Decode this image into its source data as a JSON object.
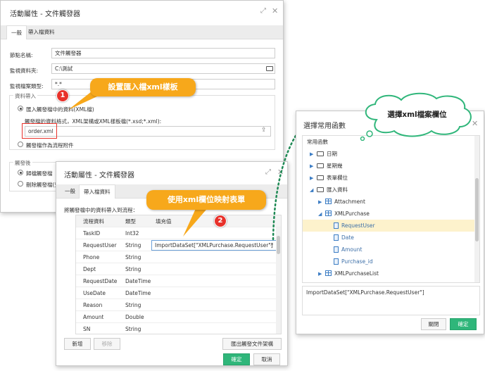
{
  "main_dialog": {
    "title": "活動屬性 - 文件觸發器",
    "tabs": [
      "一般",
      "帶入檔資料"
    ],
    "fields": {
      "node_name_label": "節點名稱:",
      "node_name_value": "文件觸發器",
      "watch_folder_label": "監視資料夾:",
      "watch_folder_value": "C:\\測試",
      "watch_type_label": "監視檔案類型:",
      "watch_type_value": "*.*"
    },
    "import_section": {
      "legend": "資料帶入",
      "radio1": "匯入觸發檔中的資料(XML檔)",
      "schema_label": "觸發檔的資料格式，XML架構或XML樣板檔(*.xsd;*.xml):",
      "schema_value": "order.xml",
      "radio2": "觸發檔作為流程附件"
    },
    "after_section": {
      "legend": "觸發後",
      "radio1": "歸檔觸發檔",
      "radio2": "刪除觸發檔(只"
    }
  },
  "second_dialog": {
    "title": "活動屬性 - 文件觸發器",
    "tabs": [
      "一般",
      "帶入檔資料"
    ],
    "instruction": "將觸發檔中的資料帶入到流程：",
    "columns": [
      "流程資料",
      "類型",
      "填充值"
    ],
    "rows": [
      {
        "name": "TaskID",
        "type": "Int32",
        "value": ""
      },
      {
        "name": "RequestUser",
        "type": "String",
        "value": "ImportDataSet[\"XMLPurchase.RequestUser\"]"
      },
      {
        "name": "Phone",
        "type": "String",
        "value": ""
      },
      {
        "name": "Dept",
        "type": "String",
        "value": ""
      },
      {
        "name": "RequestDate",
        "type": "DateTime",
        "value": ""
      },
      {
        "name": "UseDate",
        "type": "DateTime",
        "value": ""
      },
      {
        "name": "Reason",
        "type": "String",
        "value": ""
      },
      {
        "name": "Amount",
        "type": "Double",
        "value": ""
      },
      {
        "name": "SN",
        "type": "String",
        "value": ""
      }
    ],
    "btn_add": "新增",
    "btn_remove": "移除",
    "btn_export": "匯出觸發文件架構",
    "btn_ok": "確定",
    "btn_cancel": "取消"
  },
  "func_dialog": {
    "title": "選擇常用函數",
    "header": "常用函數",
    "tree": [
      {
        "label": "日期",
        "kind": "folder",
        "expanded": false
      },
      {
        "label": "星期幾",
        "kind": "folder",
        "expanded": false
      },
      {
        "label": "表單欄位",
        "kind": "folder",
        "expanded": false
      },
      {
        "label": "匯入資料",
        "kind": "folder",
        "expanded": true
      },
      {
        "label": "Attachment",
        "kind": "table",
        "expanded": false
      },
      {
        "label": "XMLPurchase",
        "kind": "table",
        "expanded": true
      },
      {
        "label": "RequestUser",
        "kind": "field",
        "selected": true
      },
      {
        "label": "Date",
        "kind": "field"
      },
      {
        "label": "Amount",
        "kind": "field"
      },
      {
        "label": "Purchase_id",
        "kind": "field"
      },
      {
        "label": "XMLPurchaseList",
        "kind": "table",
        "expanded": false
      }
    ],
    "expression": "ImportDataSet[\"XMLPurchase.RequestUser\"]",
    "btn_close": "關閉",
    "btn_ok": "確定"
  },
  "annotations": {
    "callout1": "設置匯入檔xml樣板",
    "callout2": "使用xml欄位映射表單",
    "cloud": "選擇xml檔案欄位",
    "badge1": "1",
    "badge2": "2"
  },
  "colors": {
    "primary_button": "#2fb67a",
    "callout": "#f7a81b",
    "badge": "#e8322b",
    "selected_row": "#fdf2cc",
    "highlight_box": "#e8322b"
  }
}
